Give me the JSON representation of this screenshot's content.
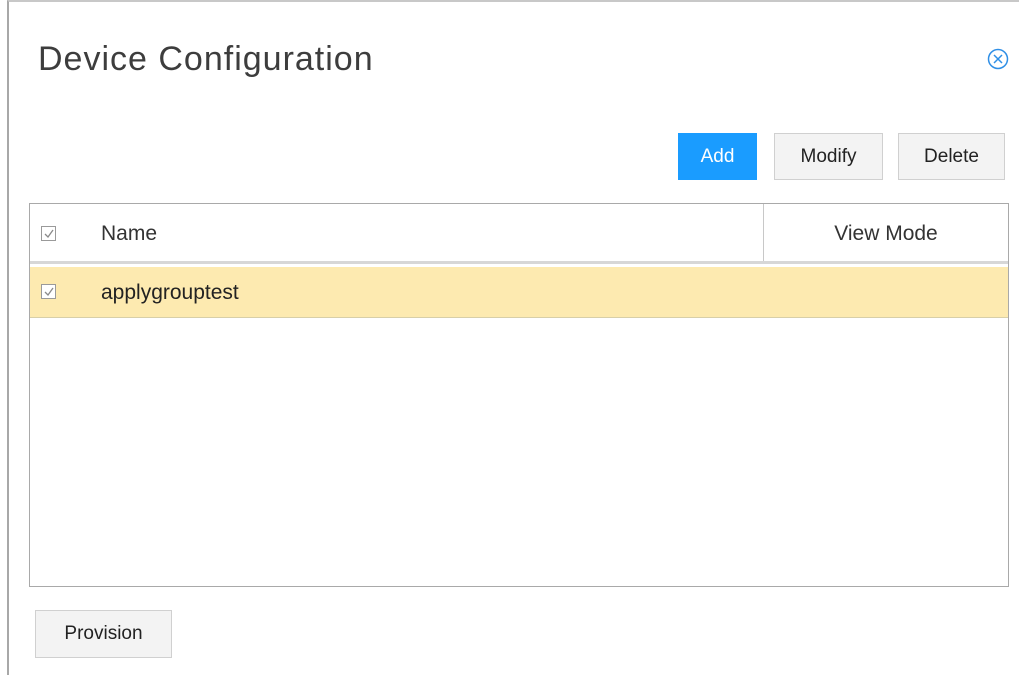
{
  "dialog": {
    "title": "Device Configuration",
    "close_icon": "circle-close-icon"
  },
  "toolbar": {
    "add_label": "Add",
    "modify_label": "Modify",
    "delete_label": "Delete"
  },
  "table": {
    "columns": [
      "Name",
      "View Mode"
    ],
    "select_all_checked": true,
    "rows": [
      {
        "name": "applygrouptest",
        "view_mode": "",
        "checked": true,
        "selected": true
      }
    ]
  },
  "footer": {
    "provision_label": "Provision"
  },
  "colors": {
    "primary_button": "#1a9cff",
    "selected_row": "#fdeab0"
  }
}
